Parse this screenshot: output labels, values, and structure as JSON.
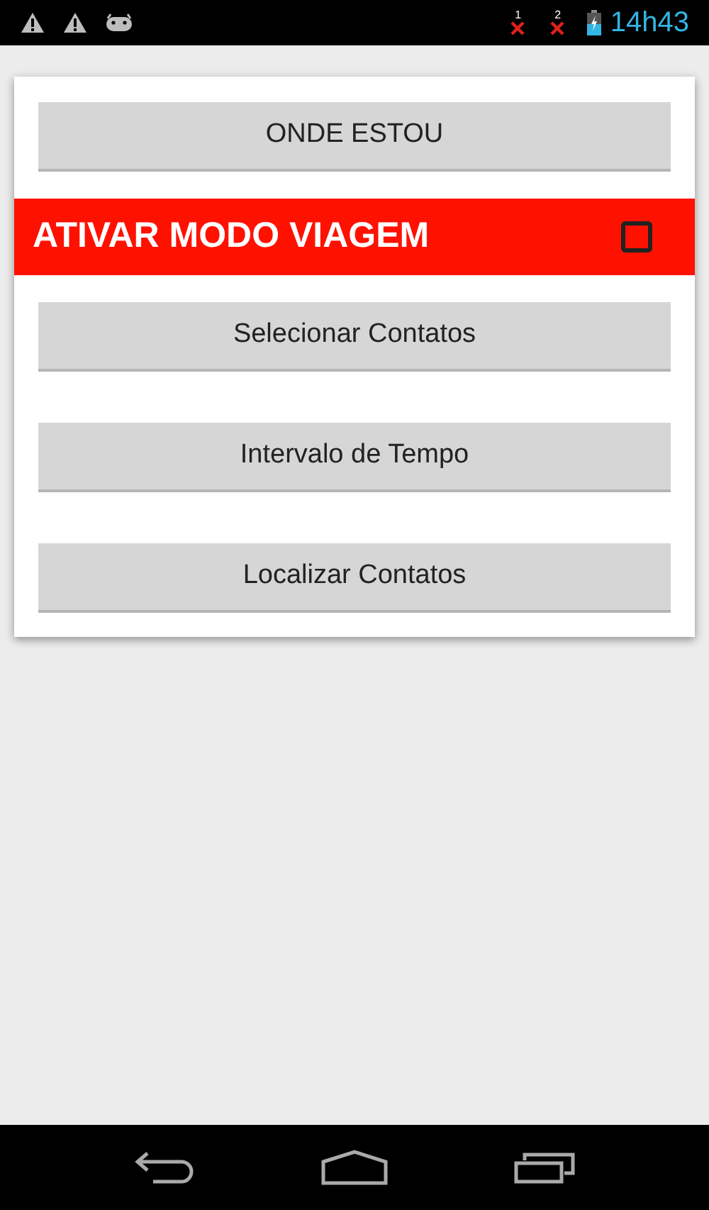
{
  "status_bar": {
    "sim_labels": [
      "1",
      "2"
    ],
    "time": "14h43"
  },
  "top_button": {
    "label": "ONDE ESTOU"
  },
  "travel_mode": {
    "label": "ATIVAR MODO VIAGEM",
    "checked": false
  },
  "buttons": [
    {
      "label": "Selecionar Contatos"
    },
    {
      "label": "Intervalo de Tempo"
    },
    {
      "label": "Localizar Contatos"
    }
  ]
}
